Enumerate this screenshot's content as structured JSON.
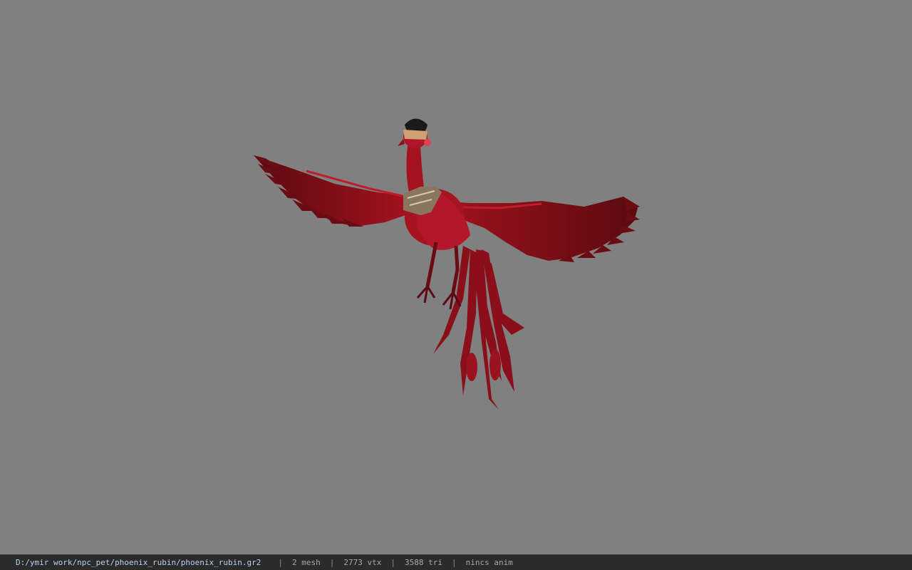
{
  "viewport": {
    "background": "#808080",
    "model_name": "phoenix_rubin"
  },
  "status": {
    "file_path": "D:/ymir work/npc_pet/phoenix_rubin/phoenix_rubin.gr2",
    "separator": "|",
    "mesh": "2 mesh",
    "vertices": "2773 vtx",
    "triangles": "3588 tri",
    "animation": "nincs anim"
  }
}
